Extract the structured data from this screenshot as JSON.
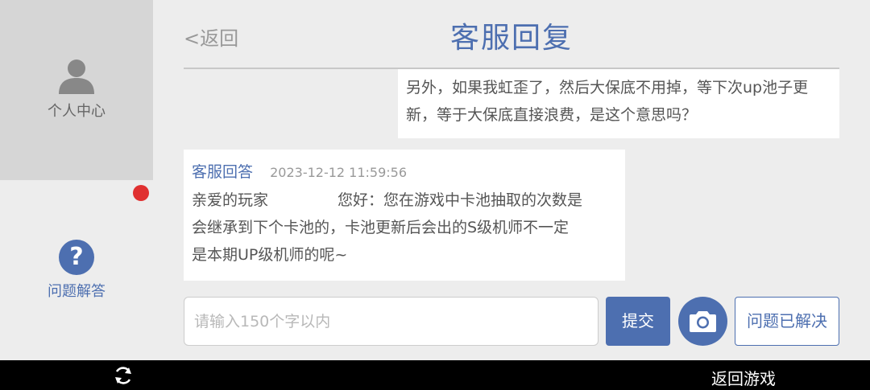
{
  "sidebar": {
    "personal_center": {
      "label": "个人中心",
      "icon": "person-icon"
    },
    "faq": {
      "label": "问题解答",
      "icon": "question-icon"
    },
    "notification_dot_color": "#e03030"
  },
  "header": {
    "back_label": "<返回",
    "title": "客服回复"
  },
  "messages": {
    "user": {
      "text": "另外，如果我虹歪了，然后大保底不用掉，等下次up池子更新，等于大保底直接浪费，是这个意思吗？"
    },
    "reply": {
      "author": "客服回答",
      "timestamp": "2023-12-12 11:59:56",
      "greeting": "亲爱的玩家",
      "text_part1": "您好：您在游戏中卡池抽取的次数是",
      "text_part2": "会继承到下个卡池的，卡池更新后会出的S级机师不一定",
      "text_part3": "是本期UP级机师的呢~"
    }
  },
  "composer": {
    "input_placeholder": "请输入150个字以内",
    "input_value": "",
    "submit_label": "提交",
    "camera_icon": "camera-icon",
    "solved_label": "问题已解决"
  },
  "bottom_bar": {
    "refresh_icon": "refresh-icon",
    "back_to_game_label": "返回游戏"
  },
  "colors": {
    "accent": "#4d6fb0",
    "background": "#ededed",
    "sidebar_selected": "#d6d6d6"
  }
}
